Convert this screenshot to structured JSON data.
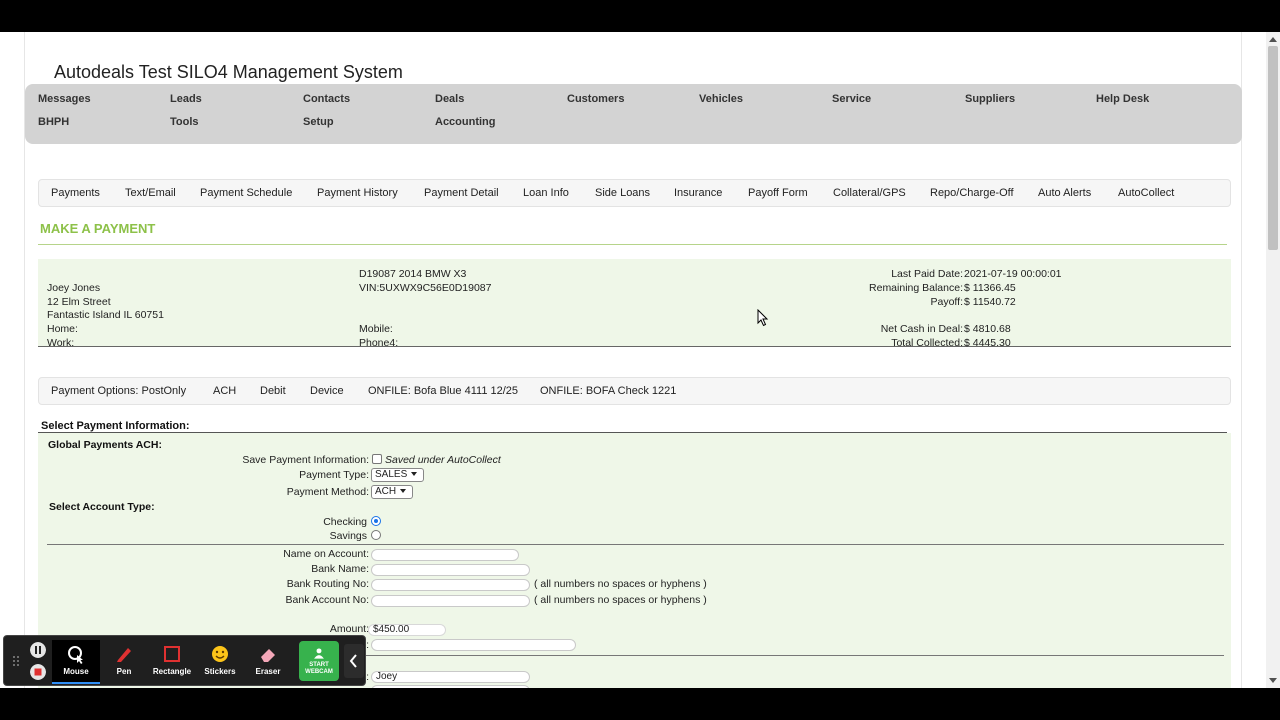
{
  "app": {
    "title": "Autodeals Test SILO4 Management System"
  },
  "main_nav": {
    "row1": [
      "Messages",
      "Leads",
      "Contacts",
      "Deals",
      "Customers",
      "Vehicles",
      "Service",
      "Suppliers",
      "Help Desk"
    ],
    "row2": [
      "BHPH",
      "Tools",
      "Setup",
      "Accounting"
    ]
  },
  "sub_nav": [
    "Payments",
    "Text/Email",
    "Payment Schedule",
    "Payment History",
    "Payment Detail",
    "Loan Info",
    "Side Loans",
    "Insurance",
    "Payoff Form",
    "Collateral/GPS",
    "Repo/Charge-Off",
    "Auto Alerts",
    "AutoCollect"
  ],
  "section": {
    "title": "MAKE A PAYMENT"
  },
  "customer": {
    "name": "Joey Jones",
    "street": "12 Elm Street",
    "city": "Fantastic Island IL 60751",
    "home_label": "Home:",
    "work_label": "Work:"
  },
  "vehicle": {
    "desc": "D19087 2014 BMW X3",
    "vin": "VIN:5UXWX9C56E0D19087",
    "mobile_label": "Mobile:",
    "phone4_label": "Phone4:"
  },
  "account": {
    "last_paid_label": "Last Paid Date:",
    "last_paid_value": "2021-07-19 00:00:01",
    "remaining_label": "Remaining Balance:",
    "remaining_value": "$ 11366.45",
    "payoff_label": "Payoff:",
    "payoff_value": "$ 11540.72",
    "net_cash_label": "Net Cash in Deal:",
    "net_cash_value": "$ 4810.68",
    "total_collected_label": "Total Collected:",
    "total_collected_value": "$ 4445.30"
  },
  "payment_options": [
    "Payment Options: PostOnly",
    "ACH",
    "Debit",
    "Device",
    "ONFILE: Bofa Blue 4111 12/25",
    "ONFILE: BOFA Check 1221"
  ],
  "form": {
    "select_title": "Select Payment Information:",
    "gateway_title": "Global Payments ACH:",
    "save_label": "Save Payment Information:",
    "save_note": "Saved under AutoCollect",
    "payment_type_label": "Payment Type:",
    "payment_type_value": "SALES",
    "payment_method_label": "Payment Method:",
    "payment_method_value": "ACH",
    "account_type_title": "Select Account Type:",
    "checking_label": "Checking",
    "savings_label": "Savings",
    "name_on_account_label": "Name on Account:",
    "bank_name_label": "Bank Name:",
    "routing_label": "Bank Routing No:",
    "routing_note": "( all numbers no spaces or hyphens )",
    "account_no_label": "Bank Account No:",
    "account_no_note": "( all numbers no spaces or hyphens )",
    "amount_label": "Amount:",
    "amount_value": "$450.00",
    "partial_label": ":",
    "first_name_label": ":",
    "first_name_value": "Joey"
  },
  "recorder_toolbar": {
    "tools": [
      "Mouse",
      "Pen",
      "Rectangle",
      "Stickers",
      "Eraser"
    ],
    "webcam_line1": "START",
    "webcam_line2": "WEBCAM",
    "colors": {
      "active_underline": "#2f8ef4",
      "webcam": "#37b24d",
      "pen": "#e03131"
    }
  },
  "colors": {
    "section_title": "#8dc149",
    "panel_bg": "#eff7e8",
    "nav_bg": "#d3d3d3"
  }
}
